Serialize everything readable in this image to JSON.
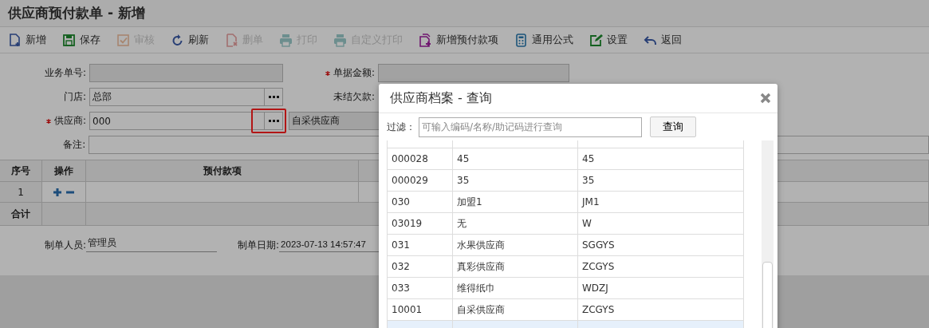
{
  "window": {
    "title": "供应商预付款单 - 新增"
  },
  "toolbar": [
    {
      "kind": "new",
      "label": "新增",
      "disabled": false
    },
    {
      "kind": "save",
      "label": "保存",
      "disabled": false
    },
    {
      "kind": "approve",
      "label": "审核",
      "disabled": true
    },
    {
      "kind": "refresh",
      "label": "刷新",
      "disabled": false
    },
    {
      "kind": "delete",
      "label": "删单",
      "disabled": true
    },
    {
      "kind": "print",
      "label": "打印",
      "disabled": true
    },
    {
      "kind": "print",
      "label": "自定义打印",
      "disabled": true
    },
    {
      "kind": "add-item",
      "label": "新增预付款项",
      "disabled": false
    },
    {
      "kind": "formula",
      "label": "通用公式",
      "disabled": false
    },
    {
      "kind": "settings",
      "label": "设置",
      "disabled": false
    },
    {
      "kind": "back",
      "label": "返回",
      "disabled": false
    }
  ],
  "form": {
    "rows": [
      {
        "fields": [
          {
            "label": "业务单号:",
            "required": false,
            "disabled": true
          },
          {
            "label": "单据金额:",
            "required": true,
            "disabled": true
          }
        ]
      },
      {
        "fields": [
          {
            "label": "门店:",
            "required": false,
            "disabled": false,
            "value": "总部",
            "picker": true,
            "highlighted": false
          },
          {
            "label": "未结欠款:",
            "required": false
          }
        ]
      },
      {
        "fields": [
          {
            "label": "供应商:",
            "required": true,
            "disabled": false,
            "value": "000",
            "picker": true,
            "highlighted": true,
            "name_value": "自采供应商"
          }
        ]
      },
      {
        "fields": [
          {
            "label": "备注:",
            "required": false,
            "disabled": false,
            "wide": true
          }
        ]
      }
    ]
  },
  "grid": {
    "columns": [
      "序号",
      "操作",
      "预付款项"
    ],
    "rows": [
      {
        "index": "1"
      }
    ],
    "total_label": "合计"
  },
  "footer": [
    {
      "label": "制单人员:",
      "value": "管理员"
    },
    {
      "label": "制单日期:",
      "value": "2023-07-13 14:57:47"
    }
  ],
  "dialog": {
    "title": "供应商档案 - 查询",
    "filter_label": "过滤：",
    "placeholder": "可输入编码/名称/助记码进行查询",
    "search_button": "查询",
    "rows": [
      {
        "code": "000028",
        "name": "45",
        "mnemonic": "45",
        "selected": false
      },
      {
        "code": "000029",
        "name": "35",
        "mnemonic": "35",
        "selected": false
      },
      {
        "code": "030",
        "name": "加盟1",
        "mnemonic": "JM1",
        "selected": false
      },
      {
        "code": "03019",
        "name": "无",
        "mnemonic": "W",
        "selected": false
      },
      {
        "code": "031",
        "name": "水果供应商",
        "mnemonic": "SGGYS",
        "selected": false
      },
      {
        "code": "032",
        "name": "真彩供应商",
        "mnemonic": "ZCGYS",
        "selected": false
      },
      {
        "code": "033",
        "name": "维得纸巾",
        "mnemonic": "WDZJ",
        "selected": false
      },
      {
        "code": "10001",
        "name": "自采供应商",
        "mnemonic": "ZCGYS",
        "selected": false
      },
      {
        "selected": true
      }
    ]
  }
}
